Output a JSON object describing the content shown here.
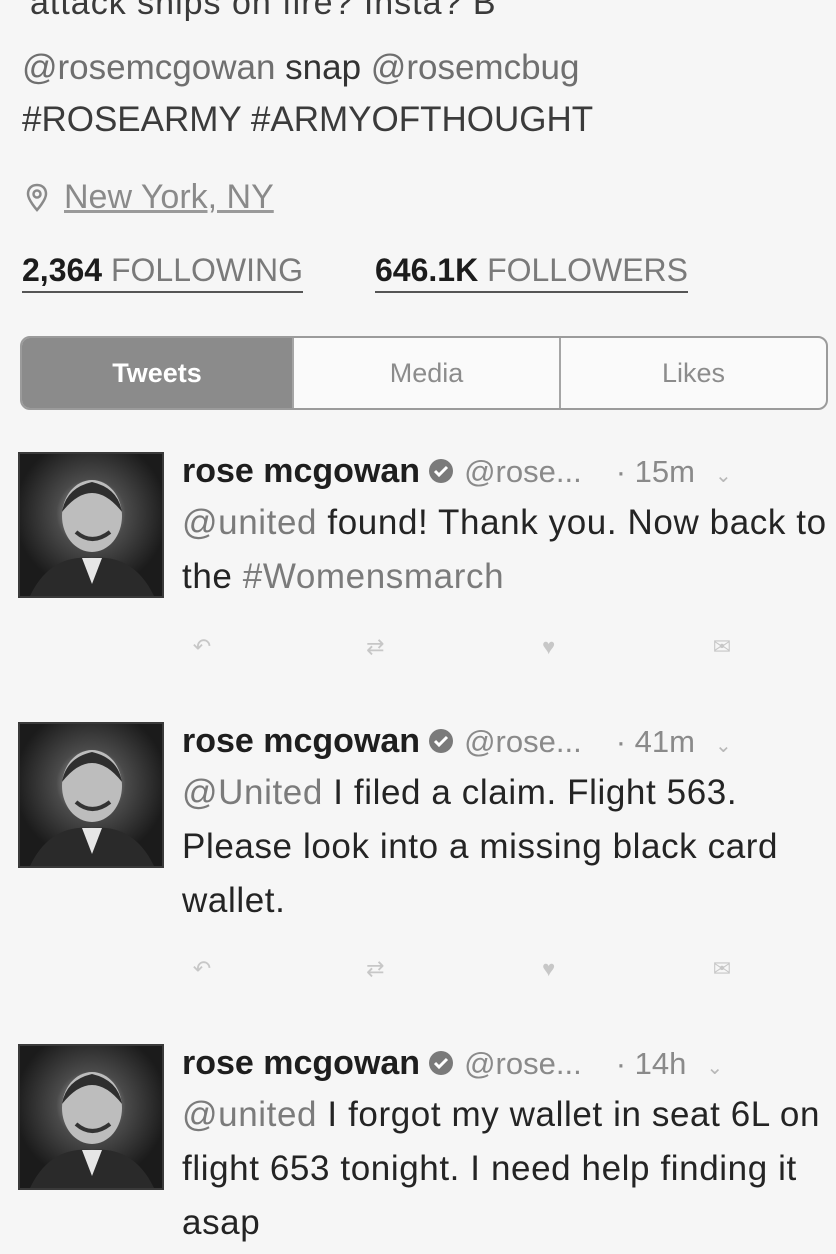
{
  "profile": {
    "cut_bio_line": "attack ships on fire? Insta? B",
    "bio_mention_1": "@rosemcgowan",
    "bio_word": "snap",
    "bio_mention_2": "@rosemcbug",
    "bio_tag_1": "#ROSEARMY",
    "bio_tag_2": "#ARMYOFTHOUGHT",
    "location": "New York, NY",
    "following_count": "2,364",
    "following_label": "FOLLOWING",
    "followers_count": "646.1K",
    "followers_label": "FOLLOWERS"
  },
  "tabs": [
    {
      "label": "Tweets",
      "active": true
    },
    {
      "label": "Media",
      "active": false
    },
    {
      "label": "Likes",
      "active": false
    }
  ],
  "tweets": [
    {
      "name": "rose mcgowan",
      "handle": "@rose...",
      "time": "· 15m",
      "mention": "@united",
      "text_a": " found! Thank you. Now back to the ",
      "hashtag": "#Womensmarch",
      "text_b": ""
    },
    {
      "name": "rose mcgowan",
      "handle": "@rose...",
      "time": "· 41m",
      "mention": "@United",
      "text_a": " I filed a claim. Flight 563. Please look into a missing black card wallet.",
      "hashtag": "",
      "text_b": ""
    },
    {
      "name": "rose mcgowan",
      "handle": "@rose...",
      "time": "· 14h",
      "mention": "@united",
      "text_a": " I forgot my wallet in seat 6L on  flight 653 tonight. I need help finding it asap",
      "hashtag": "",
      "text_b": ""
    }
  ],
  "icons": {
    "reply": "reply-icon",
    "retweet": "retweet-icon",
    "like": "heart-icon",
    "dm": "envelope-icon",
    "location": "map-pin-icon",
    "verified": "verified-badge-icon",
    "caret": "chevron-down-icon"
  },
  "colors": {
    "active_tab": "#8b8b8b",
    "link_gray": "#7b7b7b"
  }
}
